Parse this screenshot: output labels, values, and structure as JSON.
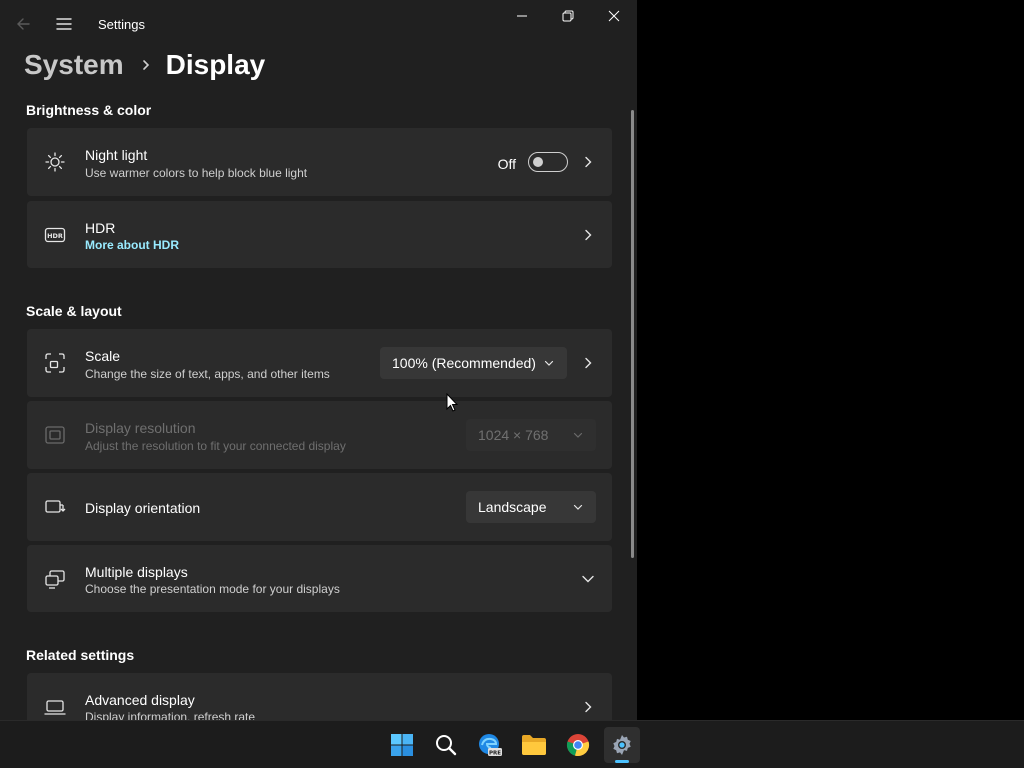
{
  "window": {
    "title": "Settings"
  },
  "breadcrumb": {
    "parent": "System",
    "current": "Display"
  },
  "sections": {
    "brightness": "Brightness & color",
    "scale_layout": "Scale & layout",
    "related": "Related settings"
  },
  "night_light": {
    "title": "Night light",
    "subtitle": "Use warmer colors to help block blue light",
    "toggle_label": "Off",
    "icon": "brightness-icon"
  },
  "hdr": {
    "title": "HDR",
    "link": "More about HDR",
    "icon": "hdr-icon"
  },
  "scale": {
    "title": "Scale",
    "subtitle": "Change the size of text, apps, and other items",
    "value": "100% (Recommended)",
    "icon": "scale-icon"
  },
  "resolution": {
    "title": "Display resolution",
    "subtitle": "Adjust the resolution to fit your connected display",
    "value": "1024 × 768",
    "icon": "resolution-icon"
  },
  "orientation": {
    "title": "Display orientation",
    "value": "Landscape",
    "icon": "orientation-icon"
  },
  "multiple": {
    "title": "Multiple displays",
    "subtitle": "Choose the presentation mode for your displays",
    "icon": "multiple-displays-icon"
  },
  "advanced": {
    "title": "Advanced display",
    "subtitle": "Display information, refresh rate",
    "icon": "laptop-icon"
  },
  "colors": {
    "background": "#202020",
    "card": "#2b2b2b",
    "accent": "#4cc2ff",
    "link": "#99ebff"
  },
  "taskbar": {
    "items": [
      {
        "name": "start",
        "icon": "windows-logo-icon"
      },
      {
        "name": "search",
        "icon": "search-icon"
      },
      {
        "name": "edge-preview",
        "icon": "edge-preview-icon"
      },
      {
        "name": "file-explorer",
        "icon": "folder-icon"
      },
      {
        "name": "chrome",
        "icon": "chrome-icon"
      },
      {
        "name": "settings",
        "icon": "gear-icon",
        "active": true
      }
    ]
  }
}
